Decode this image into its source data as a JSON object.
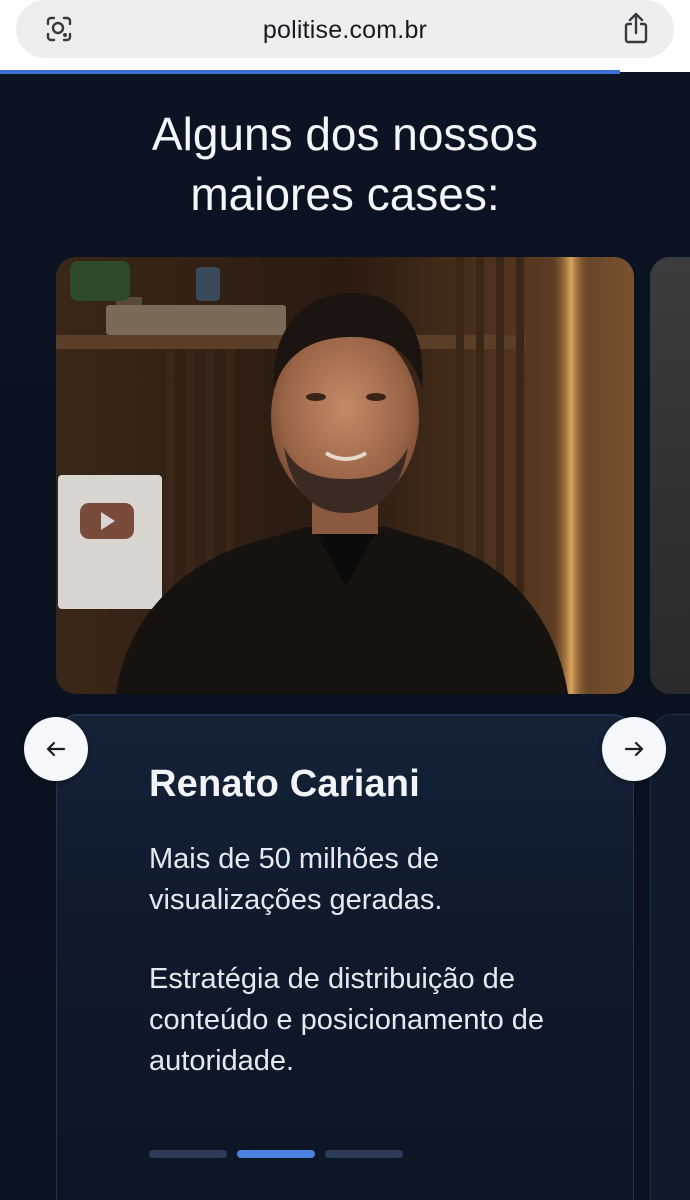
{
  "browser": {
    "url": "politise.com.br",
    "lens_icon": "visual-search-icon",
    "share_icon": "share-icon"
  },
  "section": {
    "heading_line1": "Alguns dos nossos",
    "heading_line2": "maiores cases:"
  },
  "carousel": {
    "prev_icon": "arrow-left-icon",
    "next_icon": "arrow-right-icon",
    "active_index": 1,
    "total_slides": 3,
    "current_case": {
      "name": "Renato Cariani",
      "highlight": "Mais de 50 milhões de visualizações geradas.",
      "description": "Estratégia de distribuição de conteúdo e posicionamento de autoridade.",
      "photo": "portrait-photo"
    }
  },
  "colors": {
    "background": "#0b1220",
    "accent": "#4b82e0",
    "card_border": "#243552"
  }
}
